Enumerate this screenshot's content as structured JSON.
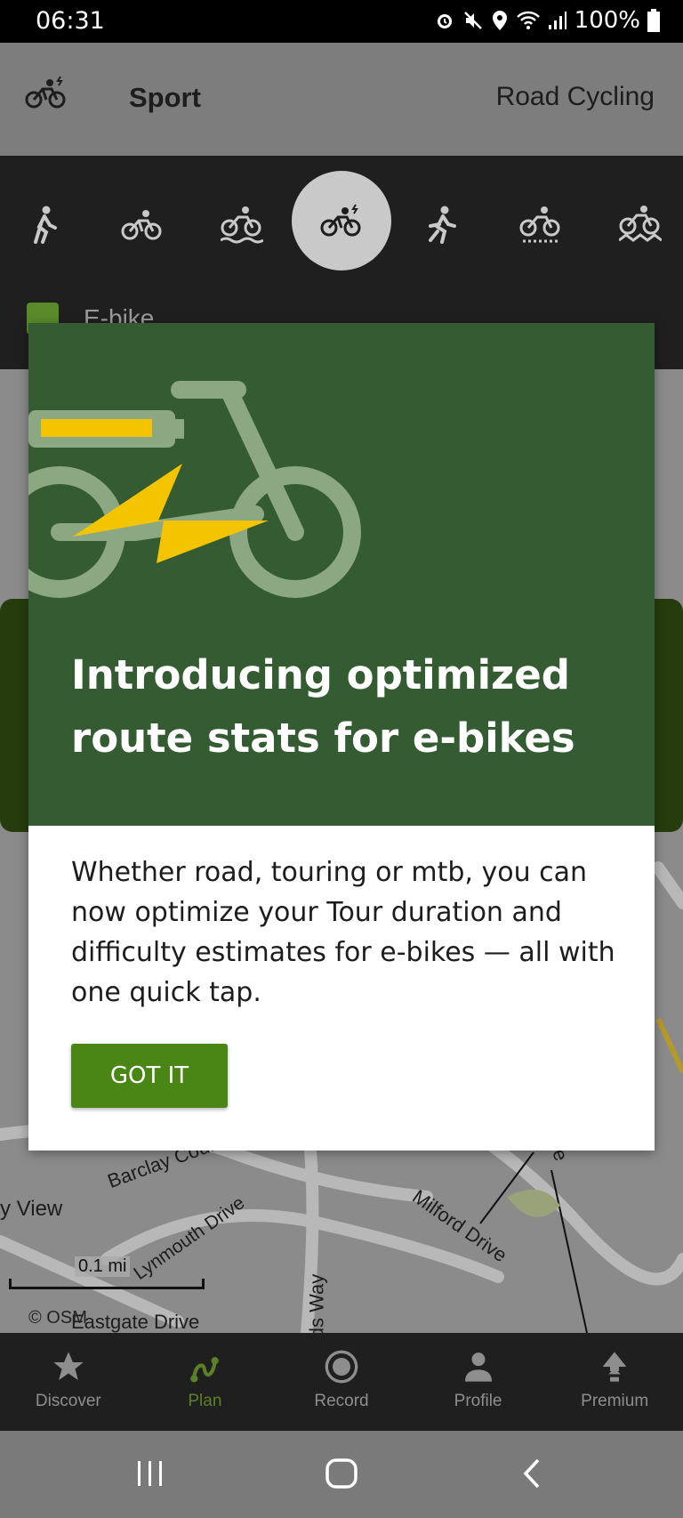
{
  "status": {
    "time": "06:31",
    "battery": "100%"
  },
  "sport": {
    "label": "Sport",
    "value": "Road Cycling"
  },
  "picker": {
    "ebike_label": "E-bike"
  },
  "map": {
    "labels": [
      "Barclay Court",
      "y View",
      "Lynmouth Drive",
      "Milford Drive",
      "ds Way",
      "Eastgate Drive",
      "ve"
    ],
    "scale": "0.1 mi",
    "attribution": "© OSM"
  },
  "dialog": {
    "title": "Introducing optimized route stats for e-bikes",
    "body": "Whether road, touring or mtb, you can now optimize your Tour duration and difficulty estimates for e-bikes — all with one quick tap.",
    "button": "GOT IT"
  },
  "nav": {
    "items": [
      {
        "label": "Discover",
        "icon": "star-icon"
      },
      {
        "label": "Plan",
        "icon": "route-icon"
      },
      {
        "label": "Record",
        "icon": "record-icon"
      },
      {
        "label": "Profile",
        "icon": "person-icon"
      },
      {
        "label": "Premium",
        "icon": "premium-icon"
      }
    ],
    "active": "Plan"
  },
  "colors": {
    "accent": "#4a8616",
    "hero": "#355b33",
    "ebike_yellow": "#f5c400"
  }
}
